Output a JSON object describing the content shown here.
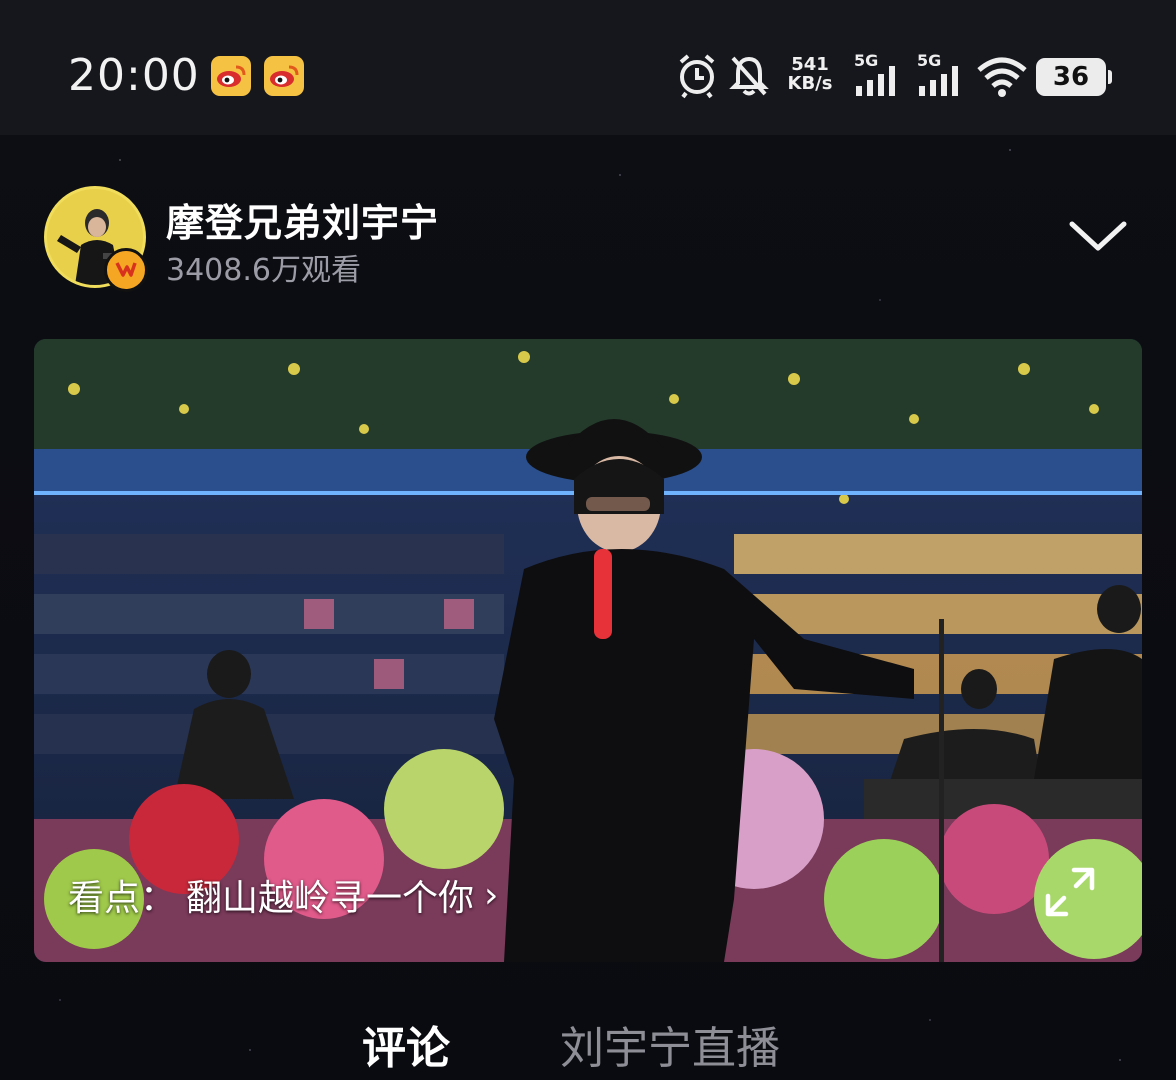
{
  "status_bar": {
    "time": "20:00",
    "net_speed_value": "541",
    "net_speed_unit": "KB/s",
    "signal1_label": "5G",
    "signal2_label": "5G",
    "battery": "36",
    "icons": [
      "weibo-icon",
      "weibo-icon",
      "alarm-icon",
      "mute-bell-icon",
      "signal-icon",
      "signal-icon",
      "wifi-icon",
      "battery-icon"
    ]
  },
  "header": {
    "channel_name": "摩登兄弟刘宇宁",
    "views": "3408.6万观看"
  },
  "video": {
    "highlight_label": "看点：",
    "highlight_title": "翻山越岭寻一个你",
    "highlight_arrow": "›"
  },
  "tabs": [
    {
      "label": "评论",
      "active": true
    },
    {
      "label": "刘宇宁直播",
      "active": false
    }
  ],
  "colors": {
    "background": "#0b0c12",
    "status_bar": "#16171d",
    "avatar_ring": "#ecd34a",
    "badge": "#f5a623",
    "weibo_icon_bg": "#f6c244",
    "inactive_tab": "#8d8e96"
  }
}
